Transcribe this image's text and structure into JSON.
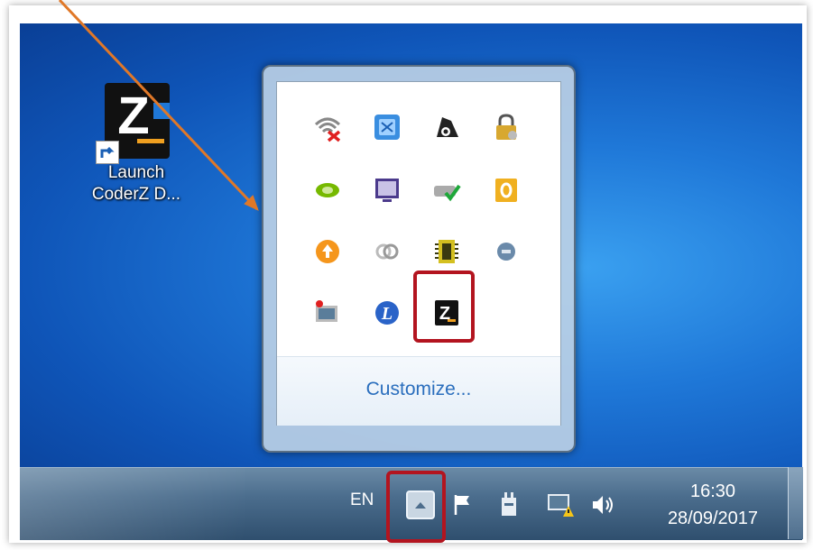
{
  "desktop": {
    "shortcut": {
      "label_line1": "Launch",
      "label_line2": "CoderZ D..."
    }
  },
  "tray_popup": {
    "icons": [
      "wifi-disconnected-icon",
      "app-blue-icon",
      "eye-scan-icon",
      "lock-icon",
      "nvidia-icon",
      "monitor-icon",
      "drive-check-icon",
      "office-icon",
      "update-orange-icon",
      "sync-icon",
      "chip-icon",
      "circle-gray-icon",
      "remote-desktop-icon",
      "logitech-icon",
      "coderz-icon"
    ],
    "customize_label": "Customize..."
  },
  "taskbar": {
    "language": "EN",
    "time": "16:30",
    "date": "28/09/2017"
  },
  "colors": {
    "highlight": "#b3141f",
    "arrow": "#e07828",
    "link": "#2a6ebd"
  }
}
